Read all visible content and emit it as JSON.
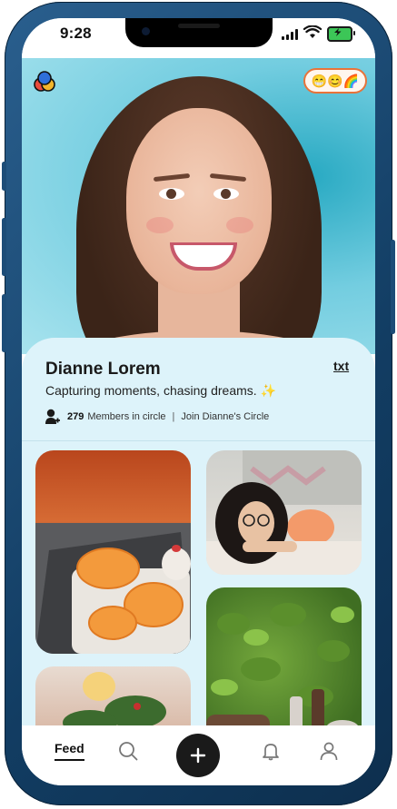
{
  "status_bar": {
    "time": "9:28"
  },
  "header": {
    "mood_emojis": "😁😊🌈",
    "logo_colors": [
      "#e94b3c",
      "#2f6fd9",
      "#f2b52b"
    ]
  },
  "profile": {
    "name": "Dianne Lorem",
    "text_button": "txt",
    "bio": "Capturing moments, chasing dreams. ✨",
    "members_count": "279",
    "members_label": "Members in circle",
    "separator": "|",
    "join_link": "Join Dianne's Circle"
  },
  "feed_photos": [
    {
      "subject": "sliced oranges and white food on a metal tray"
    },
    {
      "subject": "girl with glasses resting head on hands"
    },
    {
      "subject": "festive table with plants and candle"
    },
    {
      "subject": "picnic table with bread, shakers and green leaves"
    }
  ],
  "nav": {
    "feed_label": "Feed",
    "icons": [
      "search-icon",
      "plus-icon",
      "bell-icon",
      "user-icon"
    ]
  },
  "colors": {
    "frame": "#1d4d78",
    "card_bg": "#ddf3fa",
    "accent": "#e8733a",
    "nav_button": "#1a1a1a"
  }
}
